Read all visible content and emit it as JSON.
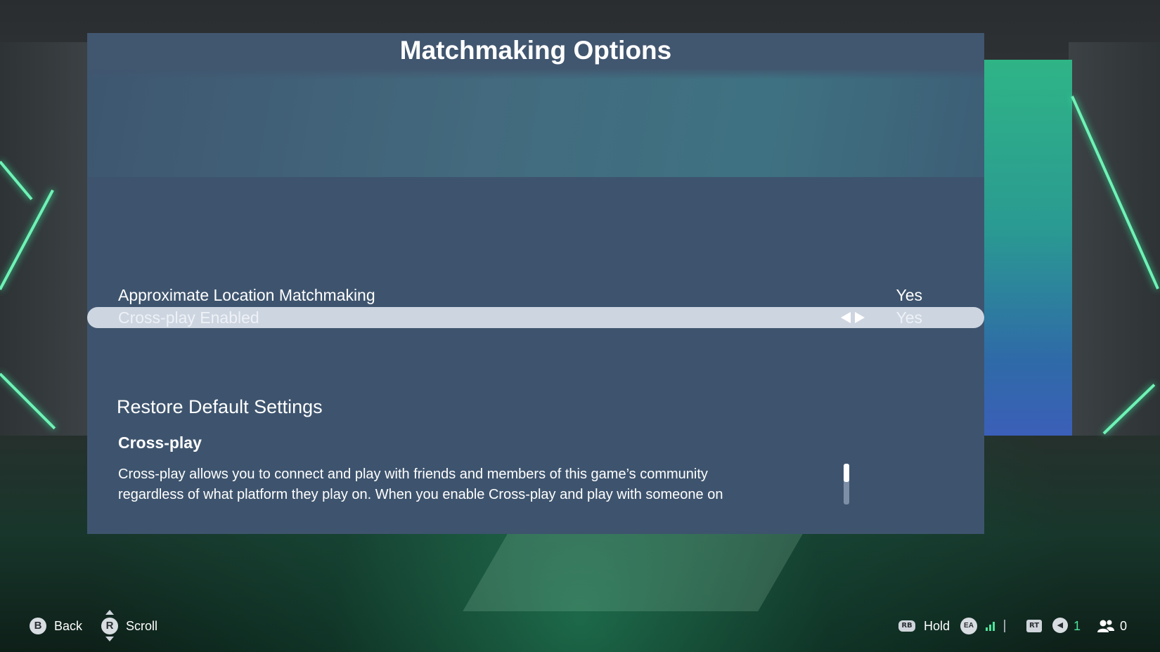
{
  "page": {
    "title": "Matchmaking Options"
  },
  "settings": [
    {
      "label": "Approximate Location Matchmaking",
      "value": "Yes"
    },
    {
      "label": "Cross-play Enabled",
      "value": "Yes",
      "selected": true
    }
  ],
  "restore_label": "Restore Default Settings",
  "description": {
    "title": "Cross-play",
    "line1": "Cross-play allows you to connect and play with friends and members of this game’s community",
    "line2": "regardless of what platform they play on. When you enable Cross-play and play with someone on"
  },
  "footer": {
    "back": {
      "button": "B",
      "label": "Back"
    },
    "scroll": {
      "button": "R",
      "label": "Scroll"
    },
    "hold": {
      "button": "RB",
      "label": "Hold"
    },
    "ea_label": "EA",
    "rt_label": "RT",
    "volume_count": "1",
    "players_count": "0"
  },
  "colors": {
    "panel": "#3e546e",
    "selected_row": "#cdd5e0",
    "accent_green": "#4fe39c"
  },
  "icons": [
    "b-button-icon",
    "r-stick-icon",
    "rb-button-icon",
    "ea-logo-icon",
    "signal-bars-icon",
    "rt-button-icon",
    "speaker-icon",
    "players-icon"
  ]
}
